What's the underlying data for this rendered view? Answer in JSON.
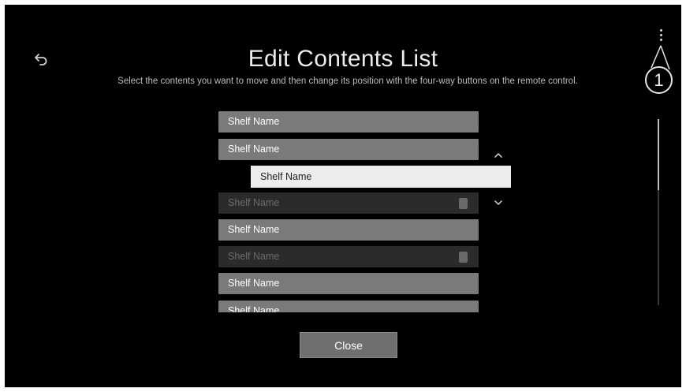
{
  "header": {
    "title": "Edit Contents List",
    "subtitle": "Select the contents you want to move and then change its position with the four-way buttons on the remote control.",
    "back_icon": "back-arrow-icon",
    "more_icon": "more-vertical-icon"
  },
  "callout": {
    "label": "1"
  },
  "shelves": [
    {
      "label": "Shelf Name",
      "state": "normal"
    },
    {
      "label": "Shelf Name",
      "state": "normal"
    },
    {
      "label": "Shelf Name",
      "state": "disabled",
      "locked": true
    },
    {
      "label": "Shelf Name",
      "state": "normal"
    },
    {
      "label": "Shelf Name",
      "state": "disabled",
      "locked": true
    },
    {
      "label": "Shelf Name",
      "state": "normal"
    },
    {
      "label": "Shelf Name",
      "state": "normal"
    }
  ],
  "selected_shelf": {
    "label": "Shelf Name"
  },
  "move_icons": {
    "up": "chevron-up-icon",
    "down": "chevron-down-icon"
  },
  "footer": {
    "close_label": "Close"
  },
  "colors": {
    "background": "#000000",
    "item_normal": "#7a7a7a",
    "item_disabled": "#2b2b2b",
    "item_selected": "#ececec",
    "button": "#6f6f6f"
  }
}
